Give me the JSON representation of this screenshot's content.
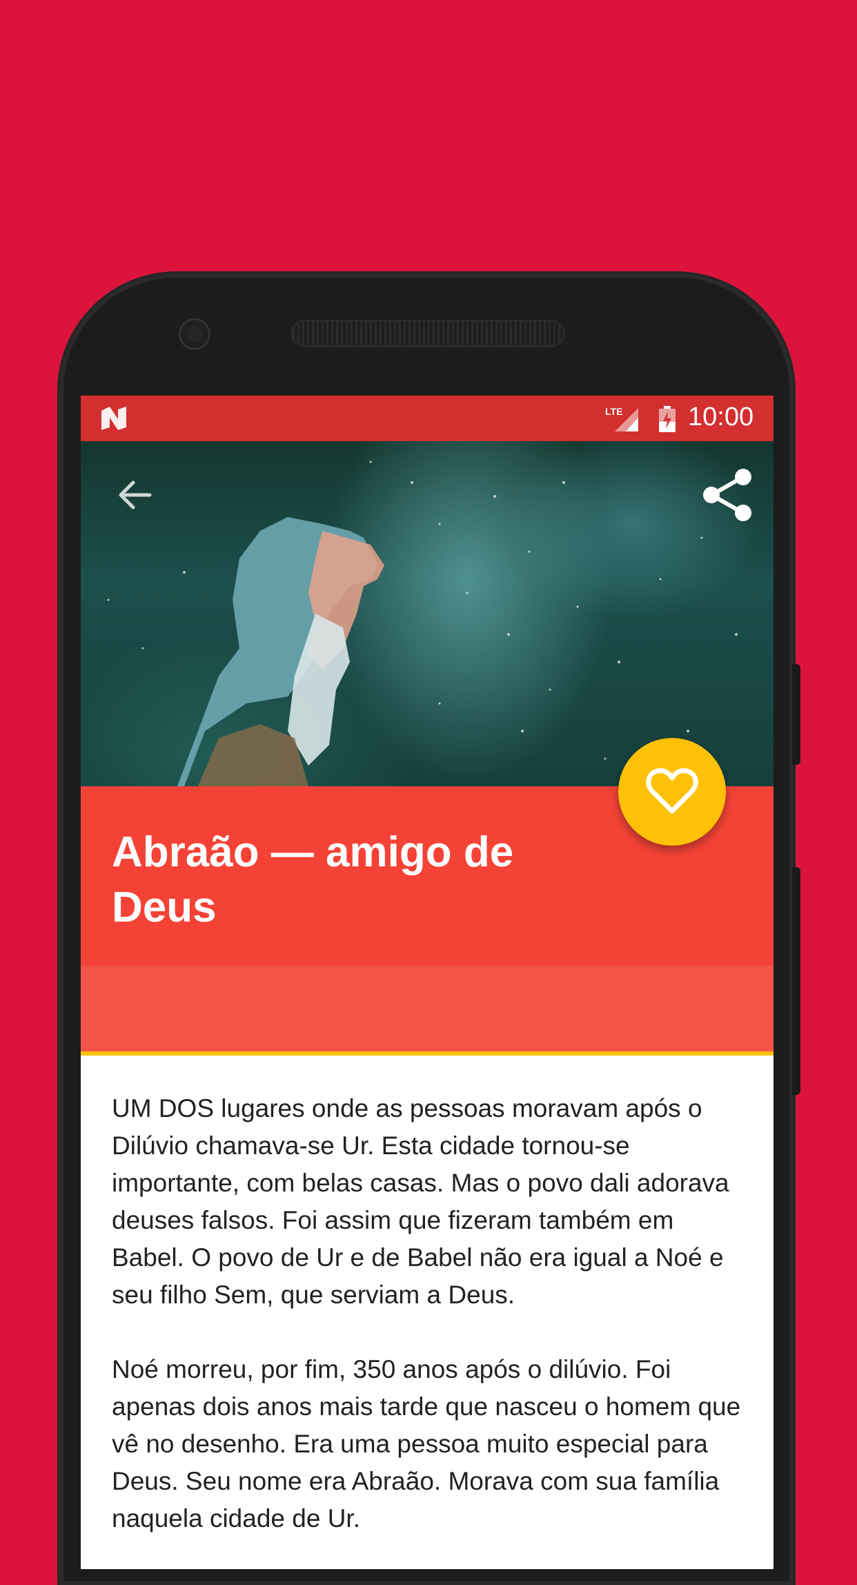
{
  "status_bar": {
    "time": "10:00",
    "network": "LTE",
    "icons": [
      "n-logo-icon",
      "lte-signal-icon",
      "battery-icon"
    ]
  },
  "toolbar": {
    "back_icon": "arrow-back-icon",
    "share_icon": "share-icon"
  },
  "hero": {
    "image_icon": "illustration"
  },
  "story": {
    "title": "Abraão — amigo de Deus",
    "favorite_icon": "heart-outline-icon",
    "paragraphs": [
      "UM DOS lugares onde as pessoas moravam após o Dilúvio chamava-se Ur. Esta cidade tornou-se importante, com belas casas. Mas o povo dali adorava deuses falsos. Foi assim que fizeram também em Babel. O povo de Ur e de Babel não era igual a Noé e seu filho Sem, que serviam a Deus.",
      "Noé morreu, por fim, 350 anos após o dilúvio. Foi apenas dois anos mais tarde que nasceu o homem que vê no desenho. Era uma pessoa muito especial para Deus. Seu nome era Abraão. Morava com sua família naquela cidade de Ur."
    ]
  },
  "colors": {
    "background": "#dc143c",
    "status_bar": "#d32f2f",
    "title_band": "#f44336",
    "fab": "#ffc107"
  }
}
